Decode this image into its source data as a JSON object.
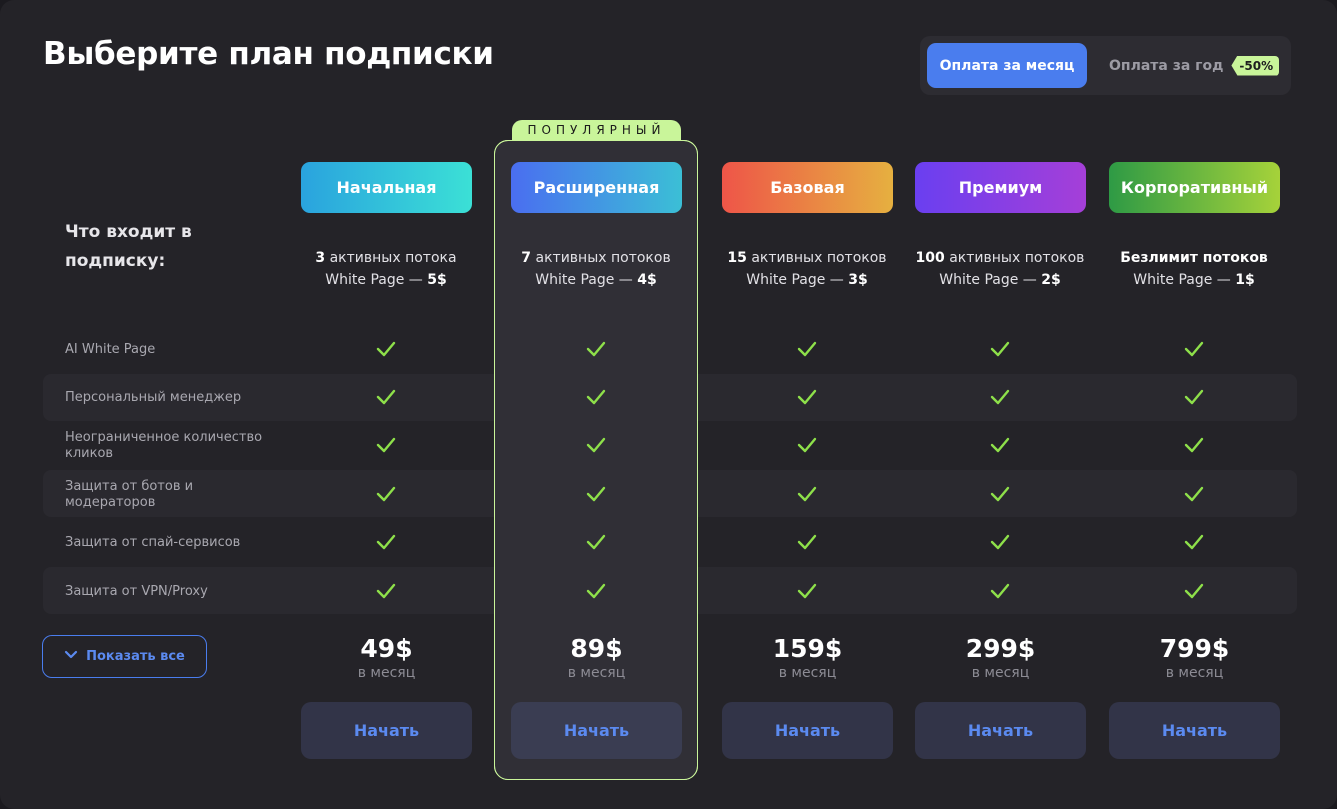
{
  "title": "Выберите план подписки",
  "billing": {
    "monthly_label": "Оплата за месяц",
    "yearly_label": "Оплата за год",
    "discount_badge": "-50%",
    "selected": "monthly"
  },
  "features_heading": "Что входит в подписку:",
  "popular_label": "ПОПУЛЯРНЫЙ",
  "features": [
    "AI White Page",
    "Персональный менеджер",
    "Неограниченное количество кликов",
    "Защита от ботов и модераторов",
    "Защита от спай-сервисов",
    "Защита от VPN/Proxy"
  ],
  "show_all_label": "Показать все",
  "plans": [
    {
      "name": "Начальная",
      "streams_count": "3",
      "streams_text": " активных потока",
      "wp_text": "White Page — ",
      "wp_price": "5$",
      "price": "49$",
      "period": "в месяц",
      "button": "Начать",
      "gradient": [
        "#2aa3de",
        "#3be0d6"
      ],
      "included": [
        true,
        true,
        true,
        true,
        true,
        true
      ]
    },
    {
      "name": "Расширенная",
      "streams_count": "7",
      "streams_text": " активных потоков",
      "wp_text": "White Page — ",
      "wp_price": "4$",
      "price": "89$",
      "period": "в месяц",
      "button": "Начать",
      "gradient": [
        "#4a6ef0",
        "#3bbfd6"
      ],
      "popular": true,
      "included": [
        true,
        true,
        true,
        true,
        true,
        true
      ]
    },
    {
      "name": "Базовая",
      "streams_count": "15",
      "streams_text": " активных потоков",
      "wp_text": "White Page — ",
      "wp_price": "3$",
      "price": "159$",
      "period": "в месяц",
      "button": "Начать",
      "gradient": [
        "#ee5548",
        "#e6b040"
      ],
      "included": [
        true,
        true,
        true,
        true,
        true,
        true
      ]
    },
    {
      "name": "Премиум",
      "streams_count": "100",
      "streams_text": " активных потоков",
      "wp_text": "White Page — ",
      "wp_price": "2$",
      "price": "299$",
      "period": "в месяц",
      "button": "Начать",
      "gradient": [
        "#6a3ff0",
        "#a53fd8"
      ],
      "included": [
        true,
        true,
        true,
        true,
        true,
        true
      ]
    },
    {
      "name": "Корпоративный",
      "streams_count": "Безлимит потоков",
      "streams_text": "",
      "wp_text": "White Page — ",
      "wp_price": "1$",
      "price": "799$",
      "period": "в месяц",
      "button": "Начать",
      "gradient": [
        "#2e9a45",
        "#a6d23a"
      ],
      "included": [
        true,
        true,
        true,
        true,
        true,
        true
      ]
    }
  ],
  "colors": {
    "accent": "#4a7dee",
    "highlight": "#c9f59a",
    "check": "#8ee04a"
  }
}
